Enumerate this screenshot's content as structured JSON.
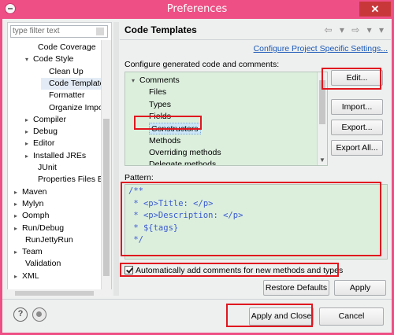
{
  "window": {
    "title": "Preferences",
    "close_label": "✕"
  },
  "left_panel": {
    "filter_placeholder": "type filter text",
    "tree": [
      {
        "label": "Code Coverage",
        "indent": 3,
        "arrow": ""
      },
      {
        "label": "Code Style",
        "indent": 2,
        "arrow": "▾"
      },
      {
        "label": "Clean Up",
        "indent": 4,
        "arrow": ""
      },
      {
        "label": "Code Templates",
        "indent": 4,
        "arrow": "",
        "selected": true
      },
      {
        "label": "Formatter",
        "indent": 4,
        "arrow": ""
      },
      {
        "label": "Organize Imports",
        "indent": 4,
        "arrow": ""
      },
      {
        "label": "Compiler",
        "indent": 2,
        "arrow": "▸"
      },
      {
        "label": "Debug",
        "indent": 2,
        "arrow": "▸"
      },
      {
        "label": "Editor",
        "indent": 2,
        "arrow": "▸"
      },
      {
        "label": "Installed JREs",
        "indent": 2,
        "arrow": "▸"
      },
      {
        "label": "JUnit",
        "indent": 3,
        "arrow": ""
      },
      {
        "label": "Properties Files Editor",
        "indent": 3,
        "arrow": ""
      },
      {
        "label": "Maven",
        "indent": 0,
        "arrow": "▸"
      },
      {
        "label": "Mylyn",
        "indent": 0,
        "arrow": "▸"
      },
      {
        "label": "Oomph",
        "indent": 0,
        "arrow": "▸"
      },
      {
        "label": "Run/Debug",
        "indent": 0,
        "arrow": "▸"
      },
      {
        "label": "RunJettyRun",
        "indent": 1,
        "arrow": ""
      },
      {
        "label": "Team",
        "indent": 0,
        "arrow": "▸"
      },
      {
        "label": "Validation",
        "indent": 1,
        "arrow": ""
      },
      {
        "label": "XML",
        "indent": 0,
        "arrow": "▸"
      }
    ]
  },
  "main": {
    "title": "Code Templates",
    "nav_arrows": "⇦ ▾ ⇨ ▾ ▾",
    "configure_link": "Configure Project Specific Settings...",
    "generated_label": "Configure generated code and comments:",
    "templates": [
      {
        "label": "Comments",
        "arrow": "▾",
        "level": 0
      },
      {
        "label": "Files",
        "arrow": "",
        "level": 1
      },
      {
        "label": "Types",
        "arrow": "",
        "level": 1
      },
      {
        "label": "Fields",
        "arrow": "",
        "level": 1
      },
      {
        "label": "Constructors",
        "arrow": "",
        "level": 1,
        "selected": true
      },
      {
        "label": "Methods",
        "arrow": "",
        "level": 1
      },
      {
        "label": "Overriding methods",
        "arrow": "",
        "level": 1
      },
      {
        "label": "Delegate methods",
        "arrow": "",
        "level": 1
      }
    ],
    "buttons": {
      "edit": "Edit...",
      "import": "Import...",
      "export": "Export...",
      "export_all": "Export All..."
    },
    "pattern_label": "Pattern:",
    "pattern_lines": [
      "/**",
      " * <p>Title: </p>",
      " * <p>Description: </p>",
      " * ${tags}",
      " */"
    ],
    "auto_comment_label": "Automatically add comments for new methods and types",
    "auto_comment_checked": true,
    "restore_defaults": "Restore Defaults",
    "apply": "Apply"
  },
  "footer": {
    "help_glyph": "?",
    "apply_close": "Apply and Close",
    "cancel": "Cancel"
  },
  "colors": {
    "titlebar": "#ee4f85",
    "editor_bg": "#dcefdd",
    "link": "#1a57b8",
    "annotation": "#e0171f"
  }
}
